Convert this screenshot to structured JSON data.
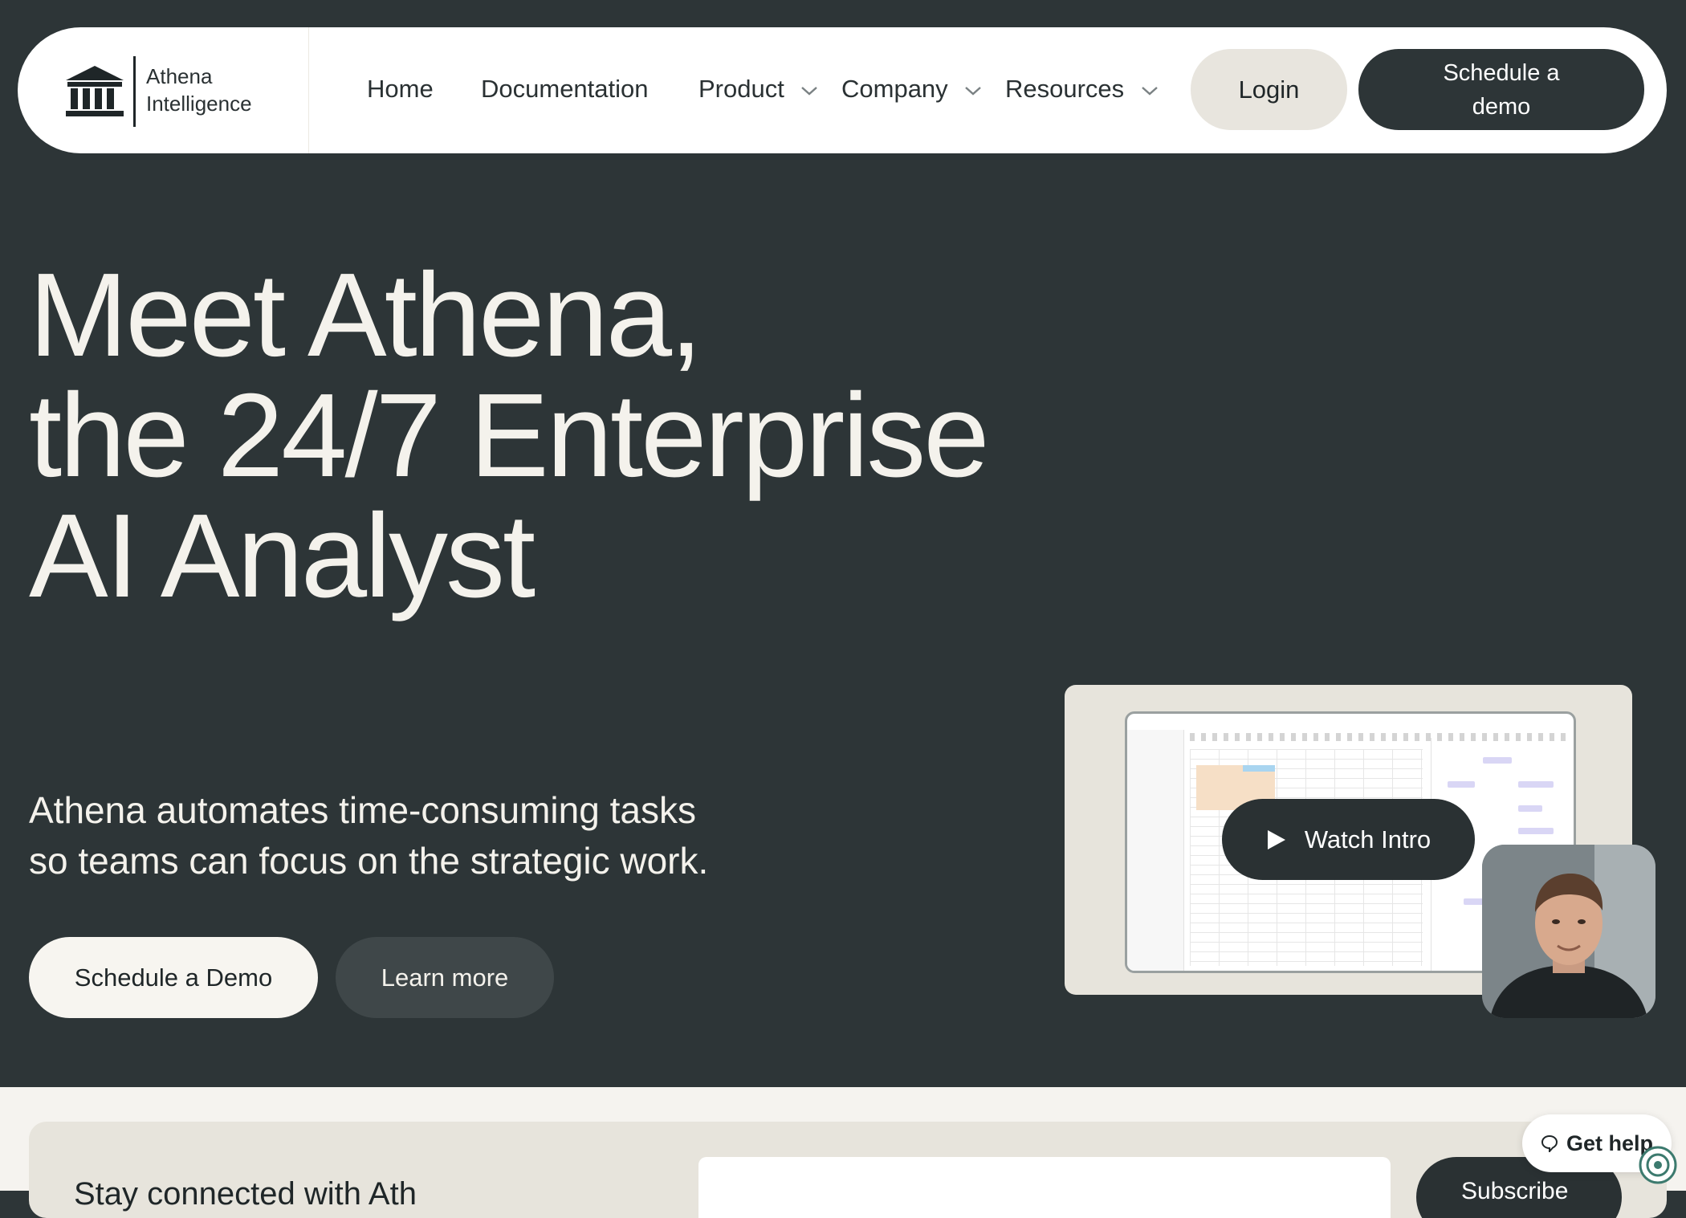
{
  "brand": {
    "line1": "Athena",
    "line2": "Intelligence"
  },
  "nav": {
    "links": [
      {
        "label": "Home"
      },
      {
        "label": "Documentation"
      },
      {
        "label": "Product"
      },
      {
        "label": "Company"
      },
      {
        "label": "Resources"
      }
    ],
    "login_label": "Login",
    "demo_label": "Schedule a demo"
  },
  "hero": {
    "title_lines": [
      "Meet Athena,",
      "the 24/7 Enterprise",
      "AI Analyst"
    ],
    "subtitle_lines": [
      "Athena automates time-consuming tasks",
      "so teams can focus on the strategic work."
    ],
    "primary_cta": "Schedule a Demo",
    "secondary_cta": "Learn more"
  },
  "video": {
    "watch_label": "Watch Intro"
  },
  "bottom": {
    "text": "Stay connected with Ath",
    "button_label": "Subscribe"
  },
  "help": {
    "label": "Get help"
  },
  "colors": {
    "background": "#2d3537",
    "nav_bg": "#ffffff",
    "login_bg": "#e8e5de",
    "dark_button": "#2d3537",
    "hero_text": "#f4f2ec",
    "card_bg": "#e7e4dc"
  }
}
